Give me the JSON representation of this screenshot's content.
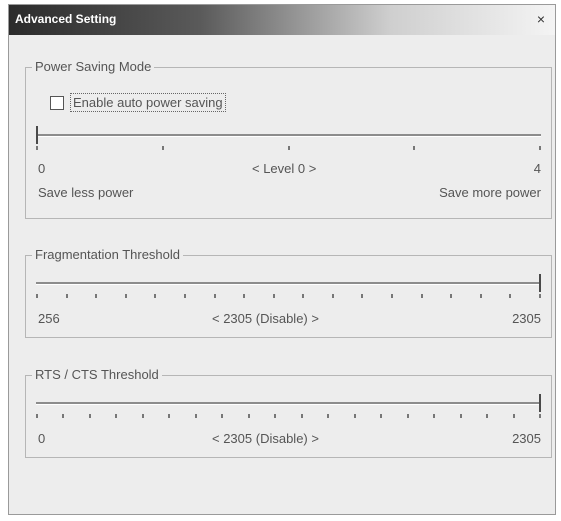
{
  "window": {
    "title": "Advanced Setting",
    "close_symbol": "×"
  },
  "power_saving": {
    "legend": "Power Saving Mode",
    "checkbox_label": "Enable auto power saving",
    "checked": false,
    "min_label": "0",
    "max_label": "4",
    "current_label": "< Level 0 >",
    "left_caption": "Save less power",
    "right_caption": "Save more power",
    "value": 0,
    "min": 0,
    "max": 4,
    "tick_count": 5
  },
  "fragmentation": {
    "legend": "Fragmentation Threshold",
    "min_label": "256",
    "max_label": "2305",
    "current_label": "< 2305 (Disable) >",
    "value": 2305,
    "min": 256,
    "max": 2305,
    "tick_count": 18
  },
  "rts_cts": {
    "legend": "RTS / CTS Threshold",
    "min_label": "0",
    "max_label": "2305",
    "current_label": "< 2305 (Disable) >",
    "value": 2305,
    "min": 0,
    "max": 2305,
    "tick_count": 20
  }
}
